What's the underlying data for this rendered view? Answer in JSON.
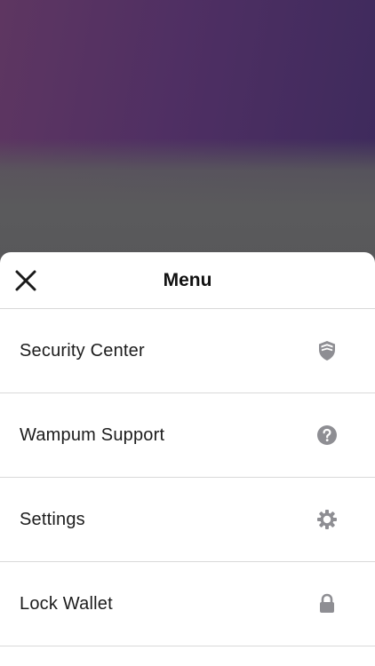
{
  "menu": {
    "title": "Menu",
    "close_icon": "close-icon",
    "items": [
      {
        "label": "Security Center",
        "icon": "shield-icon"
      },
      {
        "label": "Wampum Support",
        "icon": "help-icon"
      },
      {
        "label": "Settings",
        "icon": "gear-icon"
      },
      {
        "label": "Lock Wallet",
        "icon": "lock-icon"
      }
    ]
  },
  "colors": {
    "backdrop_purple": "#4f2f63",
    "overlay_gray": "#5a5a5c",
    "icon_gray": "#8e8e93",
    "text": "#1c1c1c",
    "divider": "#d9d9d9"
  }
}
